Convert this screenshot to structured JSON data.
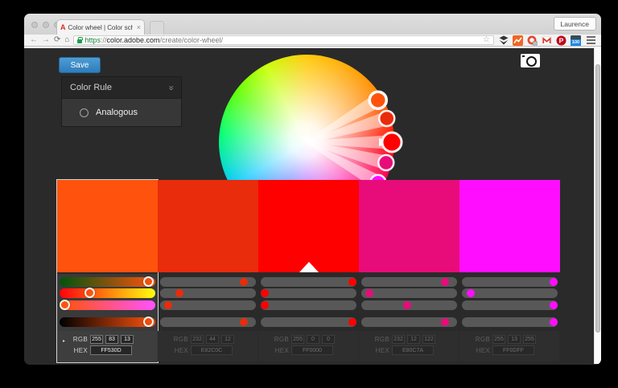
{
  "browser": {
    "user_label": "Laurence",
    "tab": {
      "title": "Color wheel | Color schem",
      "close_glyph": "×",
      "favicon_glyph": "A"
    },
    "nav": {
      "back_glyph": "←",
      "forward_glyph": "→",
      "refresh_glyph": "⟳",
      "home_glyph": "⌂"
    },
    "omnibox": {
      "url_scheme": "https",
      "url_separator": "://",
      "url_host": "color.adobe.com",
      "url_path": "/create/color-wheel/",
      "star_glyph": "☆"
    },
    "extension_badge_100": "100",
    "pinterest_glyph": "P"
  },
  "page": {
    "save_label": "Save",
    "color_rule": {
      "title": "Color Rule",
      "chevron_glyph": "»",
      "options": [
        {
          "label": "Analogous",
          "selected": true
        }
      ]
    },
    "labels": {
      "rgb": "RGB",
      "hex": "HEX",
      "selected_arrow_glyph": "▸"
    },
    "palette": [
      {
        "hex": "FF530D",
        "rgb": [
          255,
          83,
          13
        ],
        "selected": true,
        "base": false
      },
      {
        "hex": "E82C0C",
        "rgb": [
          232,
          44,
          12
        ],
        "selected": false,
        "base": false
      },
      {
        "hex": "FF0000",
        "rgb": [
          255,
          0,
          0
        ],
        "selected": false,
        "base": true
      },
      {
        "hex": "E80C7A",
        "rgb": [
          232,
          12,
          122
        ],
        "selected": false,
        "base": false
      },
      {
        "hex": "FF0DFF",
        "rgb": [
          255,
          13,
          255
        ],
        "selected": false,
        "base": false
      }
    ],
    "wheel": {
      "dots": [
        {
          "color": "#FF530D",
          "angle": 30.5,
          "radius": 103,
          "ring": "strong",
          "main": false
        },
        {
          "color": "#E82C0C",
          "angle": 16.5,
          "radius": 104,
          "ring": "normal",
          "main": false
        },
        {
          "color": "#FF0000",
          "angle": 0,
          "radius": 106,
          "ring": "normal",
          "main": true
        },
        {
          "color": "#E80C7A",
          "angle": -14.5,
          "radius": 102,
          "ring": "normal",
          "main": false
        },
        {
          "color": "#FF0DFF",
          "angle": -29.5,
          "radius": 102,
          "ring": "normal",
          "main": false
        }
      ],
      "ray_color": "rgba(255,255,255,0.5)"
    }
  },
  "colors": {
    "accent_blue": "#2e81c2",
    "page_bg": "#2a2a2a",
    "slider_track": "#585858",
    "selection_outline": "#d4d4d4"
  }
}
